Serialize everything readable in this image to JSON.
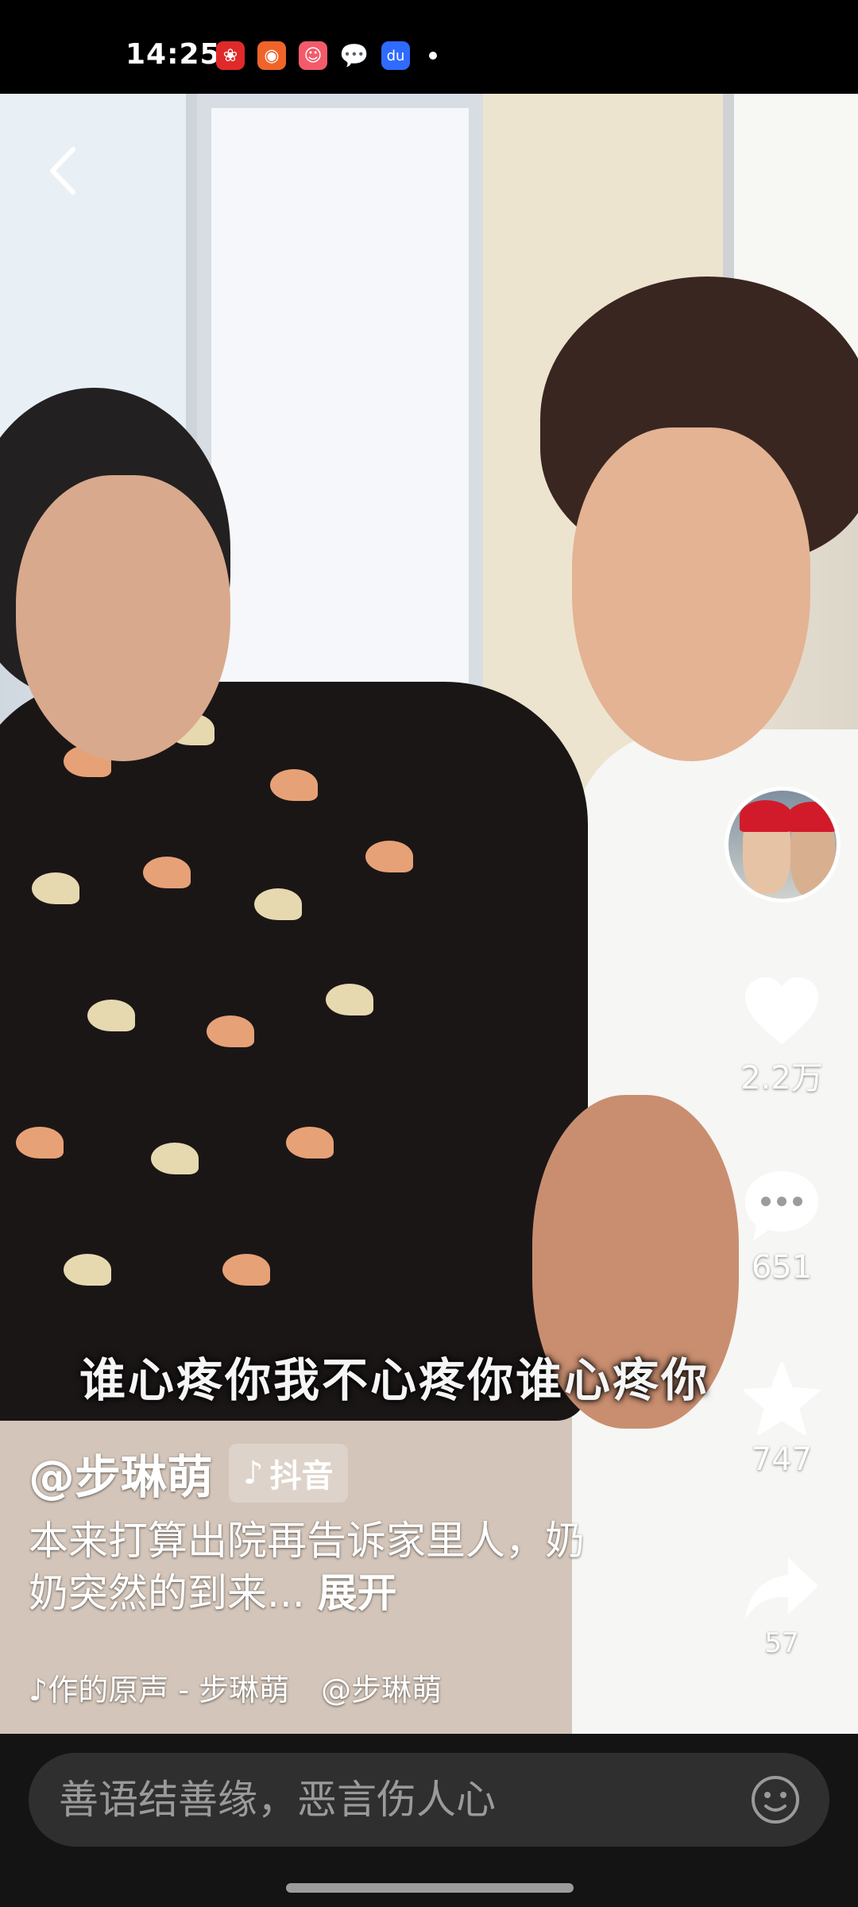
{
  "status_bar": {
    "time": "14:25",
    "icons": [
      "app-red-icon",
      "app-orange-icon",
      "app-cartoon-icon",
      "wechat-icon",
      "baidu-icon"
    ]
  },
  "video": {
    "subtitle": "谁心疼你我不心疼你谁心疼你"
  },
  "author": {
    "name": "@步琳萌",
    "platform_tag": "抖音"
  },
  "description": {
    "text": "本来打算出院再告诉家里人，奶奶突然的到来...",
    "expand_label": "展开"
  },
  "music": {
    "track": "♪作的原声 - 步琳萌",
    "mention": "@步琳萌"
  },
  "actions": {
    "likes": "2.2万",
    "comments": "651",
    "favorites": "747",
    "shares": "57"
  },
  "comment_input": {
    "placeholder": "善语结善缘，恶言伤人心"
  }
}
